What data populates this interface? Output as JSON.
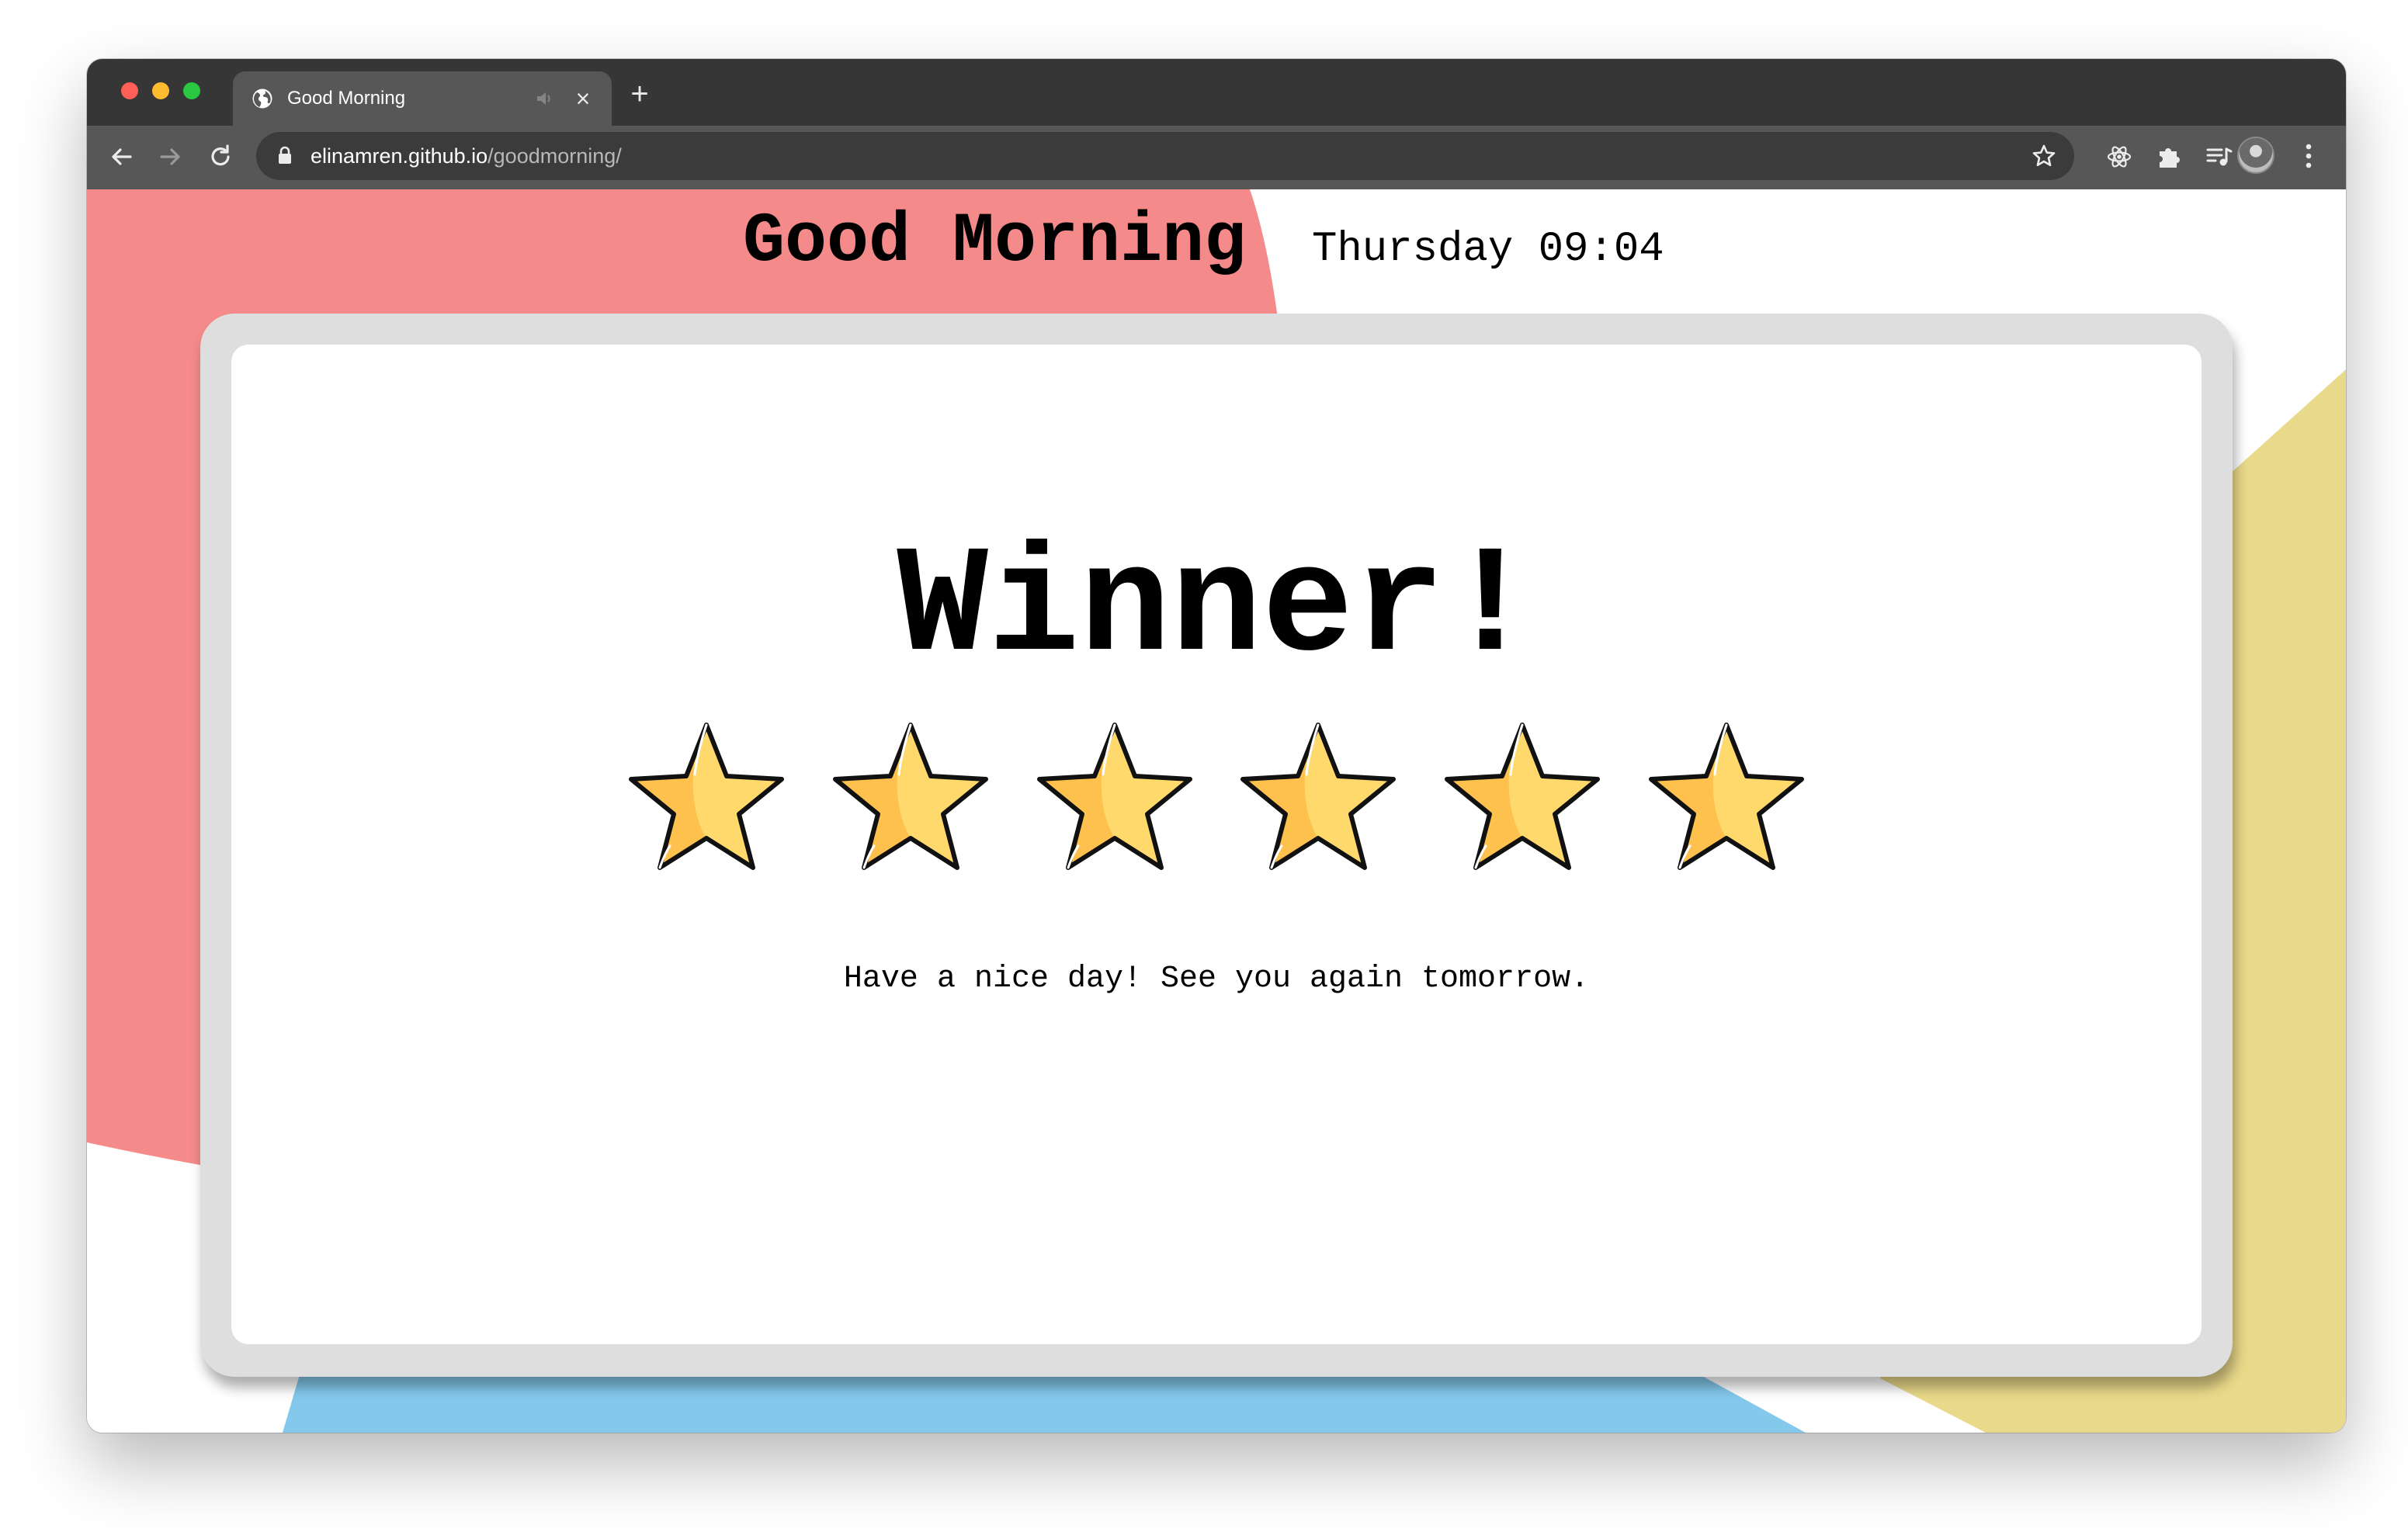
{
  "browser": {
    "tab": {
      "title": "Good Morning",
      "favicon": "globe-icon"
    },
    "toolbar": {
      "url_host": "elinamren.github.io",
      "url_path": "/goodmorning/",
      "icons": [
        "back-arrow-icon",
        "forward-arrow-icon",
        "reload-icon",
        "lock-icon",
        "bookmark-star-icon",
        "react-extension-icon",
        "puzzle-extension-icon",
        "media-queue-icon",
        "profile-avatar",
        "more-menu-icon"
      ]
    }
  },
  "page": {
    "title": "Good Morning",
    "day_time": "Thursday 09:04",
    "heading": "Winner!",
    "stars": {
      "value": 6,
      "icon": "star-icon"
    },
    "message": "Have a nice day! See you again tomorrow."
  },
  "colors": {
    "coral_shape": "#f48b8a",
    "yellow_shape": "#e9d98a",
    "blue_shape": "#84c9ec",
    "star_fill": "#ffd96c",
    "star_shade": "#ffc14d",
    "card_border": "#dedede"
  }
}
